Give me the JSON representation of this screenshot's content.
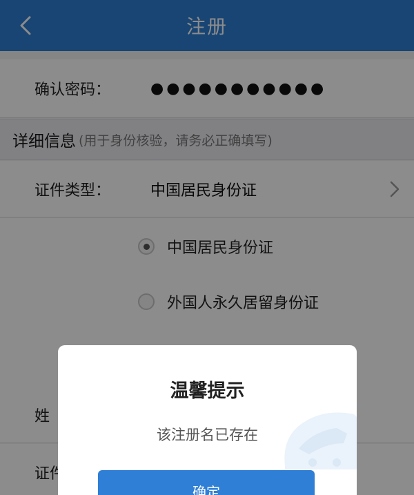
{
  "header": {
    "title": "注册",
    "back_icon": "chevron-left-icon"
  },
  "form": {
    "confirm_password": {
      "label": "确认密码：",
      "value": "●●●●●●●●●●●"
    },
    "section": {
      "title": "详细信息",
      "subtitle": "(用于身份核验，请务必正确填写)"
    },
    "id_type": {
      "label": "证件类型：",
      "value": "中国居民身份证"
    },
    "id_options": [
      {
        "label": "中国居民身份证",
        "selected": true
      },
      {
        "label": "外国人永久居留身份证",
        "selected": false
      }
    ],
    "surname_label": "姓",
    "id_number_label": "证件"
  },
  "dialog": {
    "title": "温馨提示",
    "message": "该注册名已存在",
    "confirm_label": "确定"
  },
  "colors": {
    "header": "#2c7fd1",
    "button": "#2f7fd6",
    "overlay": "rgba(0,0,0,0.45)"
  }
}
